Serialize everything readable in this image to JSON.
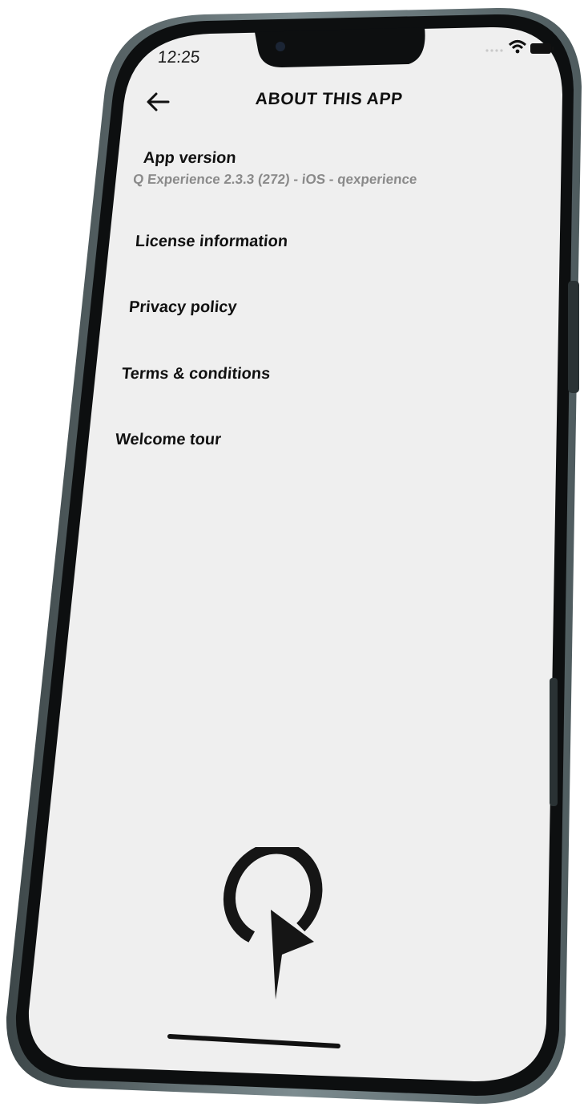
{
  "status_bar": {
    "time": "12:25",
    "icons": [
      "cellular-dots-icon",
      "wifi-icon",
      "battery-icon"
    ]
  },
  "header": {
    "title": "ABOUT THIS APP",
    "back_icon": "arrow-left-icon"
  },
  "app_version": {
    "label": "App version",
    "value": "Q Experience 2.3.3 (272) - iOS - qexperience"
  },
  "menu": {
    "items": [
      {
        "label": "License information"
      },
      {
        "label": "Privacy policy"
      },
      {
        "label": "Terms & conditions"
      },
      {
        "label": "Welcome tour"
      }
    ]
  },
  "logo": {
    "icon": "q-play-logo-icon"
  },
  "colors": {
    "screen_bg": "#efefef",
    "frame": "#0d0f10",
    "bezel_metal": "#6f7f83",
    "text_primary": "#111111",
    "text_secondary": "#8a8a8a"
  }
}
